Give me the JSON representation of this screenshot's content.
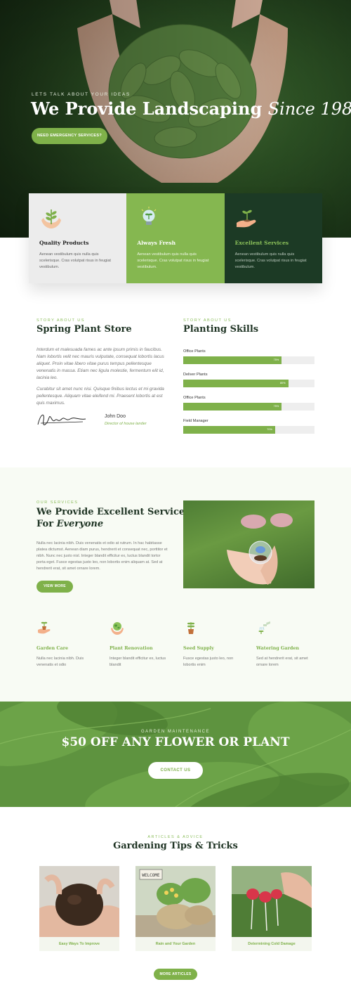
{
  "hero": {
    "eyebrow": "LETS TALK ABOUT YOUR IDEAS",
    "title_main": "We Provide Landscaping",
    "title_italic": "Since 1987",
    "button": "NEED EMERGENCY SERVICES?"
  },
  "features": [
    {
      "icon": "hands-plant-icon",
      "title": "Quality Products",
      "desc": "Aenean vestibulum quis nulla quis scelerisque. Cras volutpat risus in feugiat vestibulum."
    },
    {
      "icon": "lightbulb-plant-icon",
      "title": "Always Fresh",
      "desc": "Aenean vestibulum quis nulla quis scelerisque. Cras volutpat risus in feugiat vestibulum."
    },
    {
      "icon": "hand-sprout-icon",
      "title": "Excellent Services",
      "desc": "Aenean vestibulum quis nulla quis scelerisque. Cras volutpat risus in feugiat vestibulum."
    }
  ],
  "story": {
    "eyebrow": "STORY ABOUT US",
    "title": "Spring Plant Store",
    "p1": "Interdum et malesuada fames ac ante ipsum primis in faucibus. Nam lobortis velit nec mauris vulputate, consequat lobortis lacus aliquet. Proin vitae libero vitae purus tempus pellentesque venenatis in massa. Etiam nec ligula molestie, fermentum elit id, lacinia leo.",
    "p2": "Curabitur sit amet nunc nisi. Quisque finibus lectus et mi gravida pellentesque. Aliquam vitae eleifend mi. Praesent lobortis at est quis maximus.",
    "signer": "John Doo",
    "role": "Director of house lander"
  },
  "skills": {
    "eyebrow": "STORY ABOUT US",
    "title": "Planting Skills",
    "items": [
      {
        "label": "Office Plants",
        "value": 75,
        "pct": "75%"
      },
      {
        "label": "Deliver Plants",
        "value": 80,
        "pct": "80%"
      },
      {
        "label": "Office Plants",
        "value": 75,
        "pct": "75%"
      },
      {
        "label": "Field Manager",
        "value": 70,
        "pct": "70%"
      }
    ]
  },
  "services": {
    "eyebrow": "OUR SERVICES",
    "title_line1": "We Provide Excellent Services",
    "title_line2_prefix": "For",
    "title_line2_italic": "Everyone",
    "paragraph": "Nulla nec lacinia nibh. Duis venenatis et odio at rutrum. In hac habitasse platea dictumst. Aenean diam purus, hendrerit et consequat nec, porttitor et nibh. Nunc nec justo nisl. Integer blandit efficitur ex, luctus blandit tortor porta eget. Fusce egestas justo leo, non lobortis enim aliquam at. Sed at hendrerit erat, sit amet ornare lorem.",
    "button": "VIEW MORE",
    "items": [
      {
        "icon": "plant-pot-icon",
        "title": "Garden Care",
        "desc": "Nulla nec lacinia nibh. Duis venenatis et odio"
      },
      {
        "icon": "hands-globe-icon",
        "title": "Plant Renovation",
        "desc": "Integer blandit efficitur ex, luctus blandit"
      },
      {
        "icon": "seedling-pot-icon",
        "title": "Seed Supply",
        "desc": "Fusce egestas justo leo, non lobortis enim"
      },
      {
        "icon": "watering-can-icon",
        "title": "Watering Garden",
        "desc": "Sed at hendrerit erat, sit amet ornare lorem"
      }
    ]
  },
  "promo": {
    "eyebrow": "GARDEN MAINTENANCE",
    "title": "$50 OFF ANY FLOWER OR PLANT",
    "button": "CONTACT US"
  },
  "articles": {
    "eyebrow": "ARTICLES & ADVICE",
    "title": "Gardening Tips & Tricks",
    "items": [
      {
        "caption": "Easy Ways To Improve"
      },
      {
        "caption": "Rain and Your Garden"
      },
      {
        "caption": "Determining Cold Damage"
      }
    ],
    "sign": "WELCOME",
    "button": "MORE ARTICLES"
  },
  "colors": {
    "accent": "#7fb14a",
    "dark_green": "#1c3a25",
    "heading": "#1e3323"
  }
}
